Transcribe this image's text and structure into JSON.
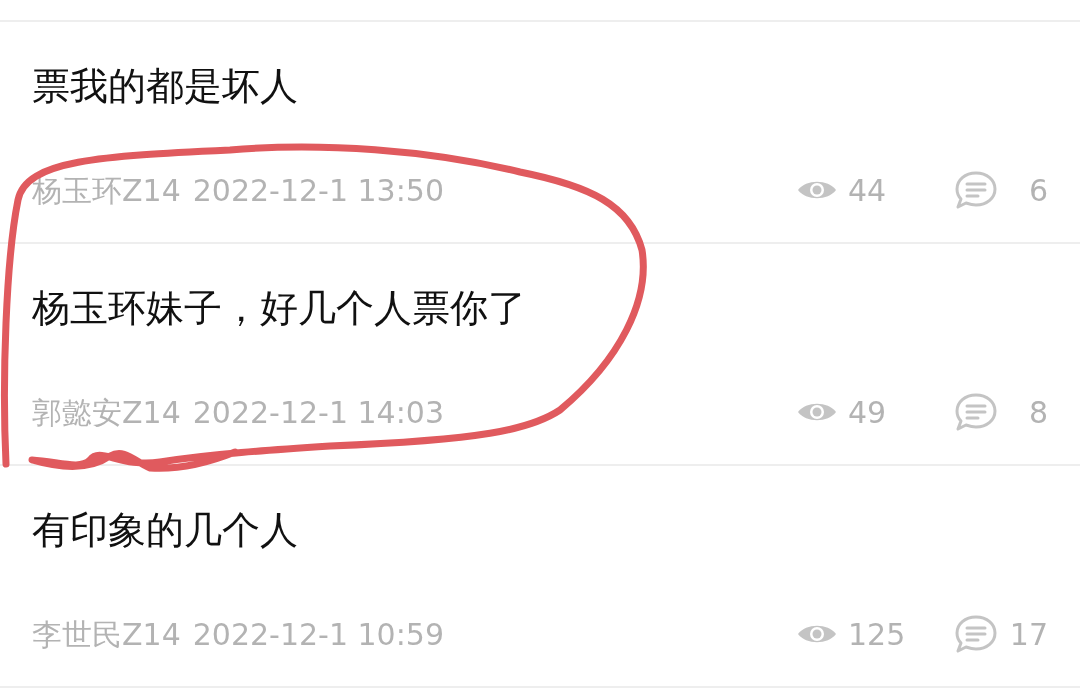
{
  "posts": [
    {
      "title": "票我的都是坏人",
      "author": "杨玉环Z14",
      "date": "2022-12-1 13:50",
      "views": "44",
      "comments": "6"
    },
    {
      "title": "杨玉环妹子，好几个人票你了",
      "author": "郭懿安Z14",
      "date": "2022-12-1 14:03",
      "views": "49",
      "comments": "8"
    },
    {
      "title": "有印象的几个人",
      "author": "李世民Z14",
      "date": "2022-12-1 10:59",
      "views": "125",
      "comments": "17"
    }
  ]
}
